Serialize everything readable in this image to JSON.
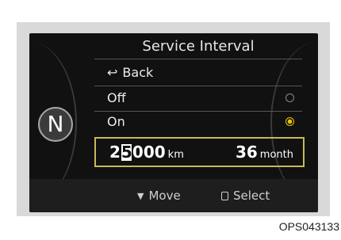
{
  "screen": {
    "gear_indicator": "N",
    "title": "Service Interval",
    "menu": {
      "back_label": "Back",
      "off_label": "Off",
      "on_label": "On",
      "selected": "On"
    },
    "interval": {
      "km_prefix": "2",
      "km_cursor_digit": "5",
      "km_suffix": "000",
      "km_unit": "km",
      "months": "36",
      "month_unit": "month"
    },
    "footer": {
      "move_label": "Move",
      "select_label": "Select"
    }
  },
  "caption": "OPS043133",
  "colors": {
    "screen_bg": "#111111",
    "accent_yellow": "#e8c400",
    "box_border": "#c9b85a"
  },
  "icons": {
    "back": "back-arrow-icon",
    "move": "down-triangle-icon",
    "select": "steering-button-icon"
  }
}
